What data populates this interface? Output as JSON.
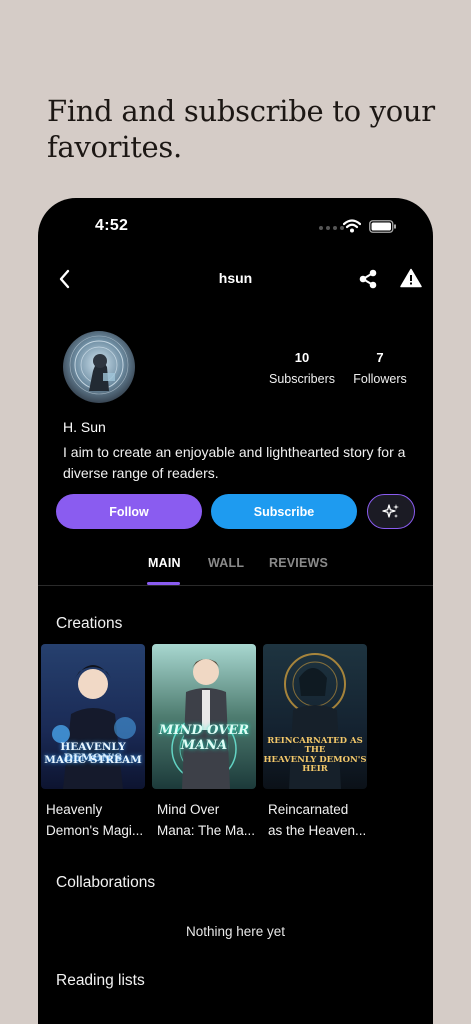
{
  "headline": "Find and subscribe to your favorites.",
  "status_bar": {
    "time": "4:52"
  },
  "nav": {
    "title": "hsun"
  },
  "profile": {
    "stats": [
      {
        "value": "10",
        "label": "Subscribers"
      },
      {
        "value": "7",
        "label": "Followers"
      }
    ],
    "name": "H. Sun",
    "bio": "I aim to create an enjoyable and lighthearted story for a diverse range of readers."
  },
  "actions": {
    "follow_label": "Follow",
    "subscribe_label": "Subscribe"
  },
  "tabs": [
    {
      "label": "MAIN",
      "active": true
    },
    {
      "label": "WALL",
      "active": false
    },
    {
      "label": "REVIEWS",
      "active": false
    }
  ],
  "sections": {
    "creations": "Creations",
    "collaborations": "Collaborations",
    "collaborations_empty": "Nothing here yet",
    "reading_lists": "Reading lists"
  },
  "creations": [
    {
      "title_line1": "Heavenly",
      "title_line2": "Demon's Magi...",
      "cover_text_1": "HEAVENLY DEMON'S",
      "cover_text_2": "MAGIC STREAM"
    },
    {
      "title_line1": "Mind Over",
      "title_line2": "Mana: The Ma...",
      "cover_text_1": "MIND OVER",
      "cover_text_2": "MANA"
    },
    {
      "title_line1": "Reincarnated",
      "title_line2": "as the Heaven...",
      "cover_text_1": "REINCARNATED AS THE",
      "cover_text_2": "HEAVENLY DEMON'S HEIR"
    }
  ],
  "colors": {
    "accent_purple": "#8a5cf0",
    "accent_blue": "#1e9bf0",
    "background": "#d5ccc7",
    "phone": "#000000"
  }
}
